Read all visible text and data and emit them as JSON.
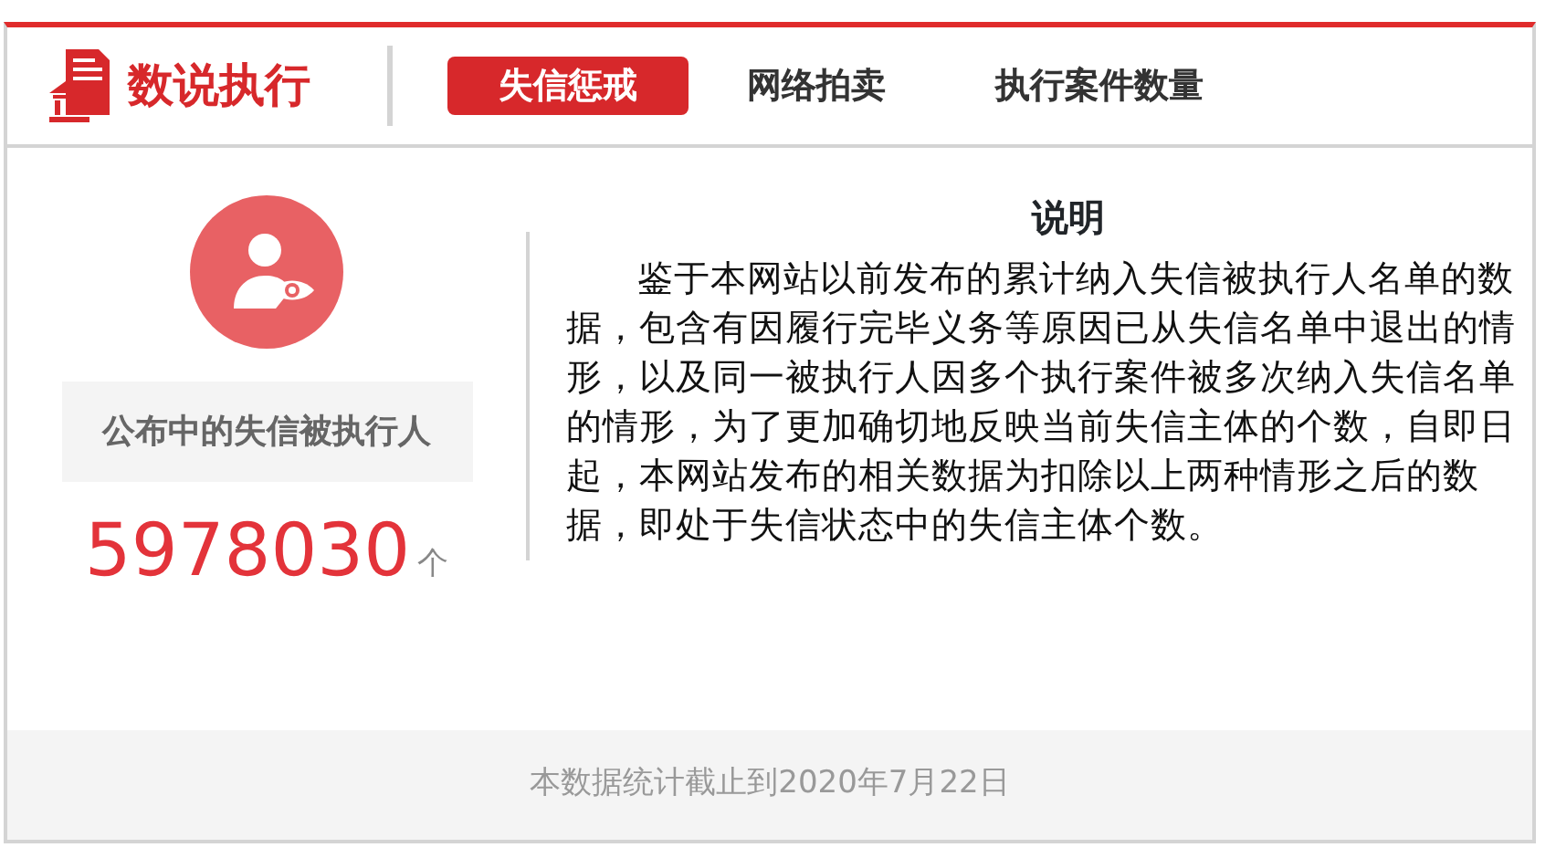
{
  "brand": {
    "title": "数说执行"
  },
  "tabs": [
    {
      "label": "失信惩戒",
      "selected": true
    },
    {
      "label": "网络拍卖",
      "selected": false
    },
    {
      "label": "执行案件数量",
      "selected": false
    }
  ],
  "stat": {
    "label": "公布中的失信被执行人",
    "value": "5978030",
    "unit": "个"
  },
  "note": {
    "title": "说明",
    "text": "鉴于本网站以前发布的累计纳入失信被执行人名单的数据，包含有因履行完毕义务等原因已从失信名单中退出的情形，以及同一被执行人因多个执行案件被多次纳入失信名单的情形，为了更加确切地反映当前失信主体的个数，自即日起，本网站发布的相关数据为扣除以上两种情形之后的数据，即处于失信状态中的失信主体个数。"
  },
  "footer": "本数据统计截止到2020年7月22日"
}
